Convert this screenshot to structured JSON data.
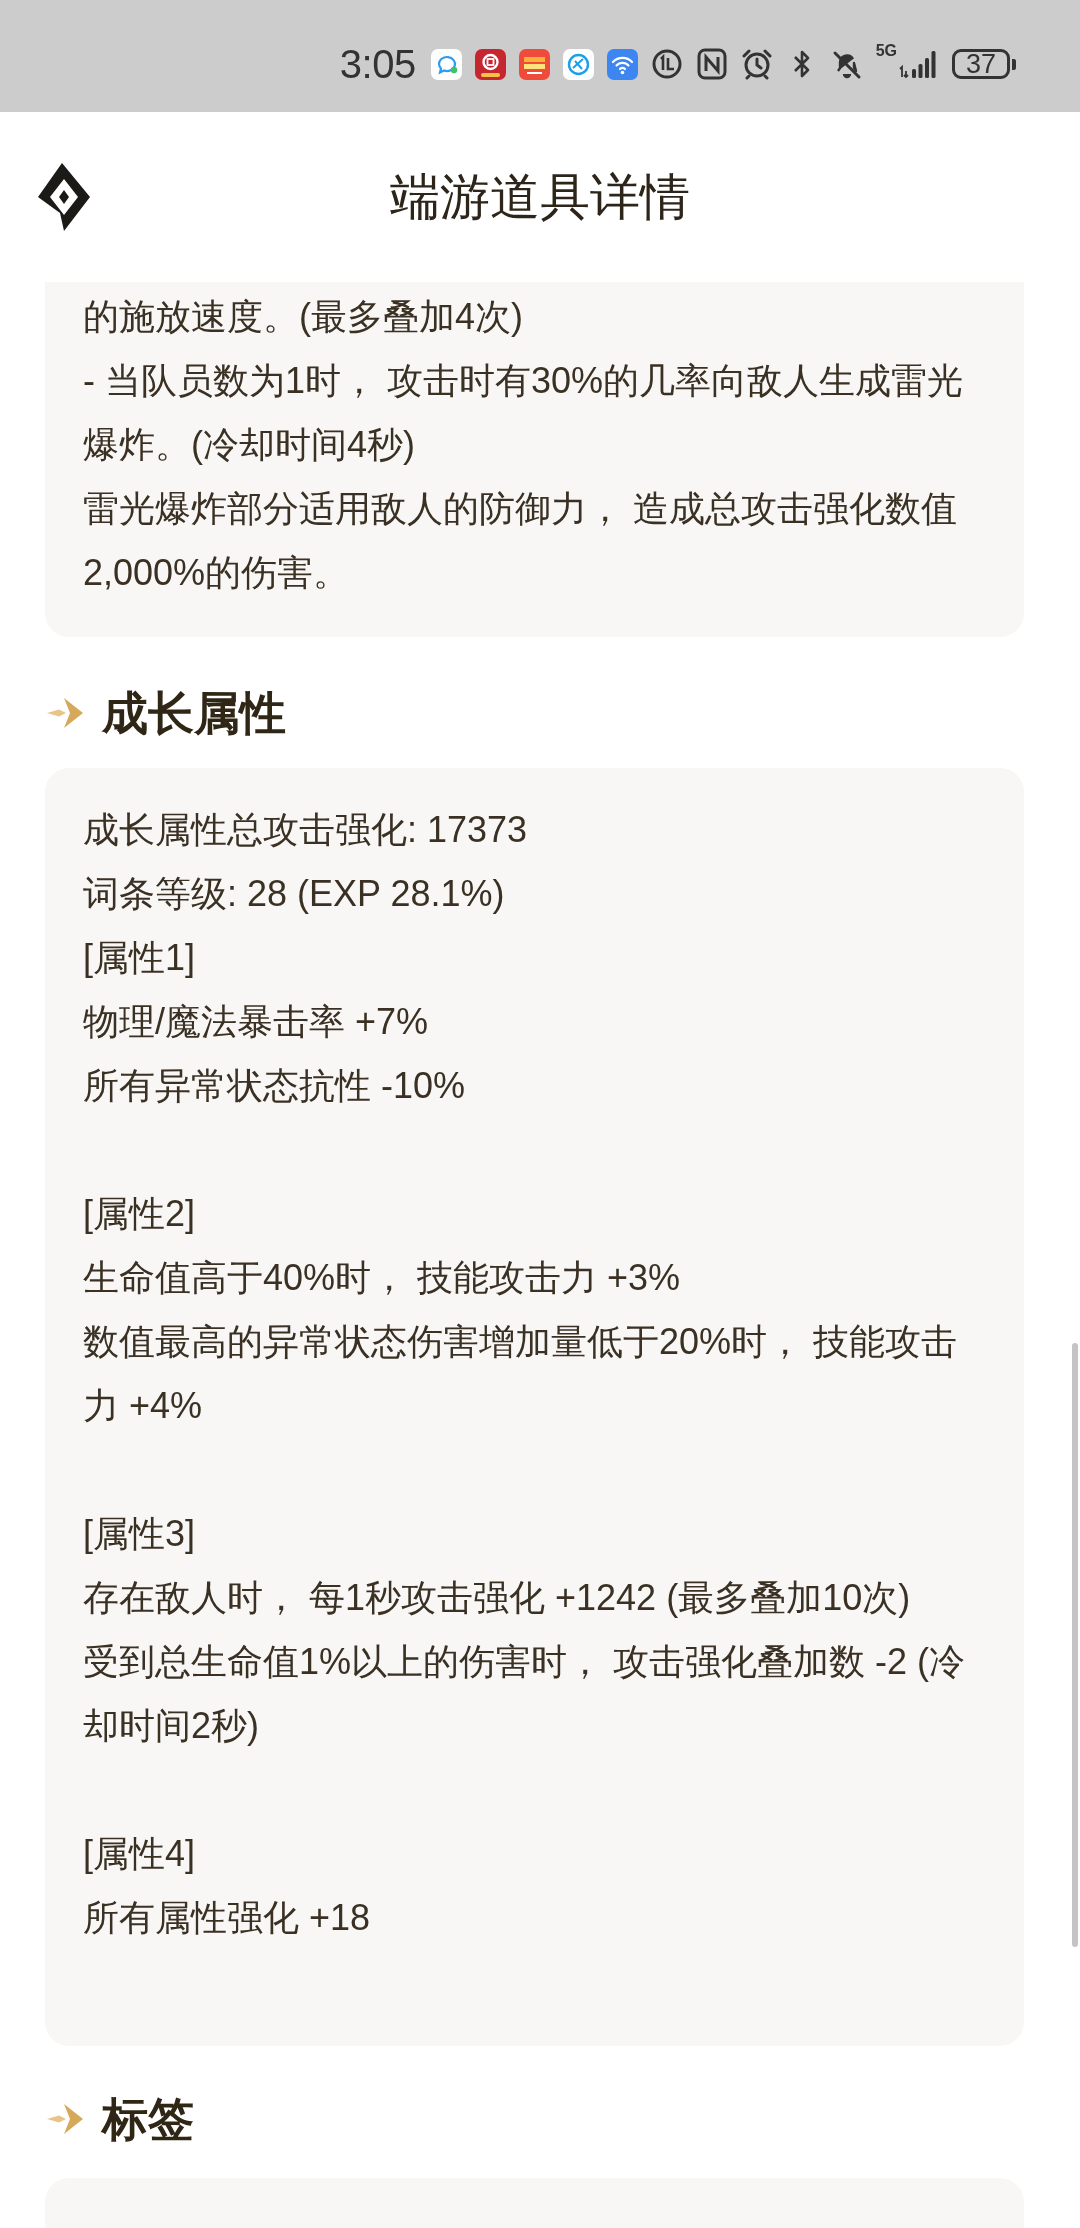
{
  "status_bar": {
    "time": "3:05",
    "network": "5G",
    "battery": "37"
  },
  "header": {
    "title": "端游道具详情"
  },
  "effect_card": {
    "paragraphs": [
      "的施放速度。(最多叠加4次)",
      "- 当队员数为1时， 攻击时有30%的几率向敌人生成雷光爆炸。(冷却时间4秒)",
      "雷光爆炸部分适用敌人的防御力， 造成总攻击强化数值2,000%的伤害。"
    ]
  },
  "growth_section": {
    "title": "成长属性",
    "summary": [
      "成长属性总攻击强化: 17373",
      "词条等级: 28 (EXP 28.1%)"
    ],
    "attributes": [
      {
        "label": "[属性1]",
        "lines": [
          "物理/魔法暴击率 +7%",
          "所有异常状态抗性 -10%"
        ]
      },
      {
        "label": "[属性2]",
        "lines": [
          "生命值高于40%时， 技能攻击力 +3%",
          "数值最高的异常状态伤害增加量低于20%时， 技能攻击力 +4%"
        ]
      },
      {
        "label": "[属性3]",
        "lines": [
          "存在敌人时， 每1秒攻击强化 +1242 (最多叠加10次)",
          "受到总生命值1%以上的伤害时， 攻击强化叠加数 -2 (冷却时间2秒)"
        ]
      },
      {
        "label": "[属性4]",
        "lines": [
          "所有属性强化 +18"
        ]
      }
    ]
  },
  "tags_section": {
    "title": "标签"
  }
}
